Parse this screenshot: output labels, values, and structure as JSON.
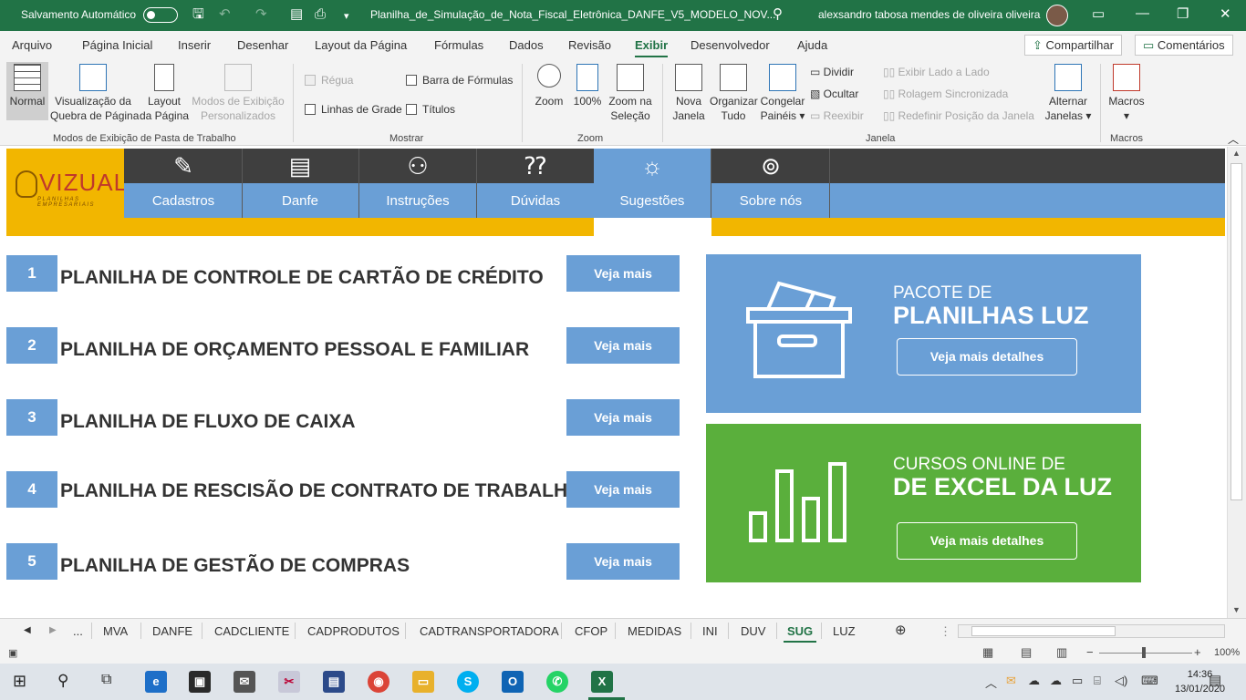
{
  "titlebar": {
    "autosave_label": "Salvamento Automático",
    "filename": "Planilha_de_Simulação_de_Nota_Fiscal_Eletrônica_DANFE_V5_MODELO_NOV...",
    "user": "alexsandro tabosa mendes de oliveira oliveira"
  },
  "menu": {
    "items": [
      "Arquivo",
      "Página Inicial",
      "Inserir",
      "Desenhar",
      "Layout da Página",
      "Fórmulas",
      "Dados",
      "Revisão",
      "Exibir",
      "Desenvolvedor",
      "Ajuda"
    ],
    "active": "Exibir",
    "share_label": "Compartilhar",
    "comments_label": "Comentários"
  },
  "ribbon": {
    "normal": "Normal",
    "page_break_1": "Visualização da",
    "page_break_2": "Quebra de Página",
    "layout_1": "Layout",
    "layout_2": "da Página",
    "custom_1": "Modos de Exibição",
    "custom_2": "Personalizados",
    "group_views": "Modos de Exibição de Pasta de Trabalho",
    "regua": "Régua",
    "barra_formulas": "Barra de Fórmulas",
    "linhas_grade": "Linhas de Grade",
    "titulos": "Títulos",
    "group_show": "Mostrar",
    "zoom": "Zoom",
    "zoom100": "100%",
    "zoom_sel_1": "Zoom na",
    "zoom_sel_2": "Seleção",
    "group_zoom": "Zoom",
    "nova_1": "Nova",
    "nova_2": "Janela",
    "organizar_1": "Organizar",
    "organizar_2": "Tudo",
    "congelar_1": "Congelar",
    "congelar_2": "Painéis",
    "dividir": "Dividir",
    "ocultar": "Ocultar",
    "reexibir": "Reexibir",
    "lado_a_lado": "Exibir Lado a Lado",
    "rolagem": "Rolagem Sincronizada",
    "redefinir": "Redefinir Posição da Janela",
    "alternar_1": "Alternar",
    "alternar_2": "Janelas",
    "group_janela": "Janela",
    "macros": "Macros",
    "group_macros": "Macros"
  },
  "sheet": {
    "logo_text": "VIZUAL",
    "logo_sub": "PLANILHAS EMPRESARIAIS",
    "nav": [
      {
        "label": "Cadastros",
        "icon": "pencil-icon"
      },
      {
        "label": "Danfe",
        "icon": "newspaper-icon"
      },
      {
        "label": "Instruções",
        "icon": "presentation-icon"
      },
      {
        "label": "Dúvidas",
        "icon": "question-people-icon"
      },
      {
        "label": "Sugestões",
        "icon": "lightbulb-icon"
      },
      {
        "label": "Sobre nós",
        "icon": "owl-icon"
      }
    ],
    "active_nav": "Sugestões",
    "items": [
      {
        "num": "1",
        "title": "PLANILHA DE CONTROLE DE CARTÃO DE CRÉDITO",
        "button": "Veja mais"
      },
      {
        "num": "2",
        "title": "PLANILHA DE ORÇAMENTO PESSOAL E FAMILIAR",
        "button": "Veja mais"
      },
      {
        "num": "3",
        "title": "PLANILHA DE FLUXO DE CAIXA",
        "button": "Veja mais"
      },
      {
        "num": "4",
        "title": "PLANILHA DE RESCISÃO DE CONTRATO DE TRABALHO",
        "button": "Veja mais"
      },
      {
        "num": "5",
        "title": "PLANILHA DE GESTÃO DE COMPRAS",
        "button": "Veja mais"
      }
    ],
    "promo1": {
      "line1": "PACOTE DE",
      "line2": "PLANILHAS LUZ",
      "button": "Veja mais detalhes",
      "color": "#6a9fd6"
    },
    "promo2": {
      "line1": "CURSOS ONLINE DE",
      "line2": "DE EXCEL DA LUZ",
      "button": "Veja mais detalhes",
      "color": "#5aaf3c"
    }
  },
  "tabs": {
    "ellipsis": "...",
    "items": [
      "MVA",
      "DANFE",
      "CADCLIENTE",
      "CADPRODUTOS",
      "CADTRANSPORTADORA",
      "CFOP",
      "MEDIDAS",
      "INI",
      "DUV",
      "SUG",
      "LUZ"
    ],
    "active": "SUG"
  },
  "status": {
    "zoom": "100%"
  },
  "taskbar": {
    "time": "14:36",
    "date": "13/01/2020"
  }
}
